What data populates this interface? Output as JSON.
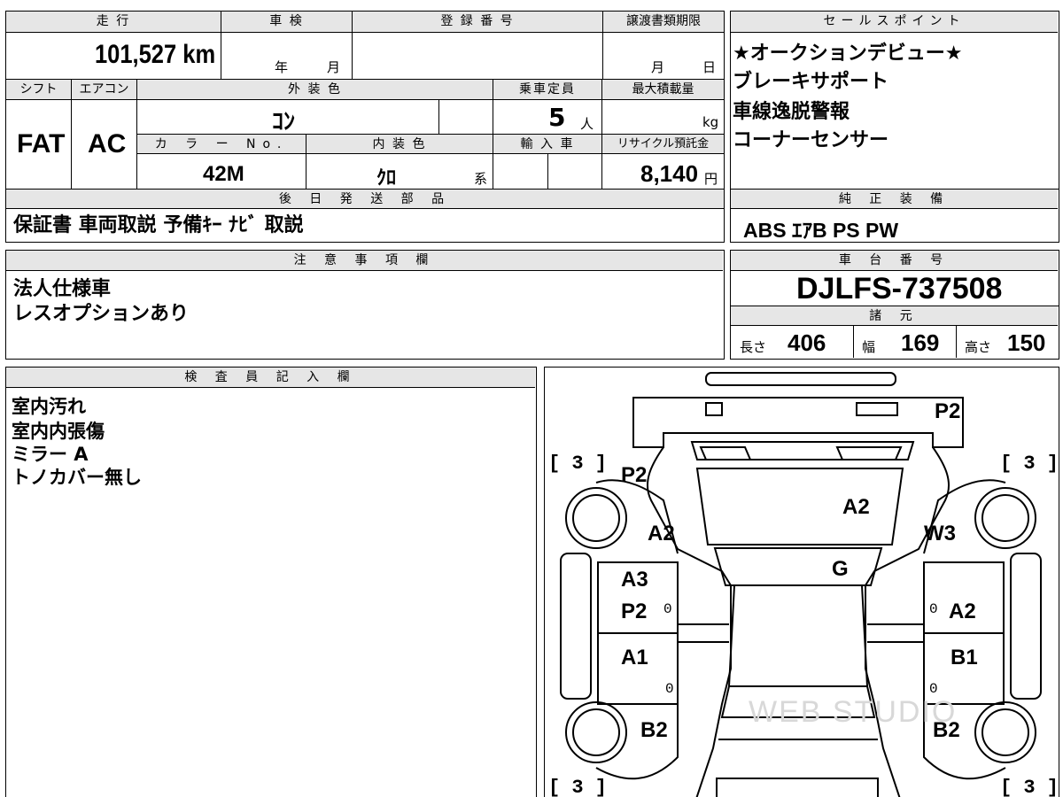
{
  "basic": {
    "mileage_label": "走 行",
    "mileage_value": "101,527 km",
    "inspection_label": "車 検",
    "inspection_year_unit": "年",
    "inspection_month_unit": "月",
    "registration_label": "登 録 番 号",
    "transfer_label": "譲渡書類期限",
    "transfer_month_unit": "月",
    "transfer_day_unit": "日",
    "shift_label": "シフト",
    "shift_value": "FAT",
    "aircon_label": "エアコン",
    "aircon_value": "AC",
    "exterior_color_label": "外 装 色",
    "exterior_color_value": "ｺﾝ",
    "capacity_label": "乗車定員",
    "capacity_value": "5",
    "capacity_unit": "人",
    "max_load_label": "最大積載量",
    "max_load_unit": "kg",
    "color_no_label": "カ ラ ー No.",
    "color_no_value": "42M",
    "interior_color_label": "内 装 色",
    "interior_color_value": "ｸﾛ",
    "interior_color_suffix": "系",
    "import_label": "輸 入 車",
    "recycle_label": "リサイクル預託金",
    "recycle_value": "8,140",
    "recycle_unit": "円"
  },
  "later_parts": {
    "label": "後 日 発 送 部 品",
    "value": "保証書 車両取説 予備ｷｰ ﾅﾋﾞ 取説"
  },
  "sales_points": {
    "label": "セールスポイント",
    "items": [
      "★オークションデビュー★",
      "ブレーキサポート",
      "車線逸脱警報",
      "コーナーセンサー"
    ]
  },
  "standard_equipment": {
    "label": "純 正 装 備",
    "value": "ABS ｴｱB PS PW"
  },
  "notes": {
    "label": "注 意 事 項 欄",
    "lines": [
      "法人仕様車",
      "レスオプションあり"
    ]
  },
  "chassis": {
    "label": "車 台 番 号",
    "value": "DJLFS-737508"
  },
  "specs": {
    "label": "諸 元",
    "length_label": "長さ",
    "length_value": "406",
    "width_label": "幅",
    "width_value": "169",
    "height_label": "高さ",
    "height_value": "150"
  },
  "inspector": {
    "label": "検 査 員 記 入 欄",
    "lines": [
      "室内汚れ",
      "室内内張傷",
      "ミラー A",
      "トノカバー無し"
    ]
  },
  "diagram": {
    "marks": {
      "rear_top": "P2",
      "roof": "A2",
      "front_left_fender_p": "P2",
      "front_left_fender_a": "A2",
      "front_right_fender": "W3",
      "windshield": "G",
      "left_front_door_a": "A3",
      "left_front_door_p": "P2",
      "right_front_door": "A2",
      "left_rear_door": "A1",
      "right_rear_door": "B1",
      "left_rear_quarter": "B2",
      "right_rear_quarter": "B2",
      "door_zero": "0",
      "tire_bracket": "[ 3 ]"
    },
    "watermark": "WEB STUDIO"
  }
}
